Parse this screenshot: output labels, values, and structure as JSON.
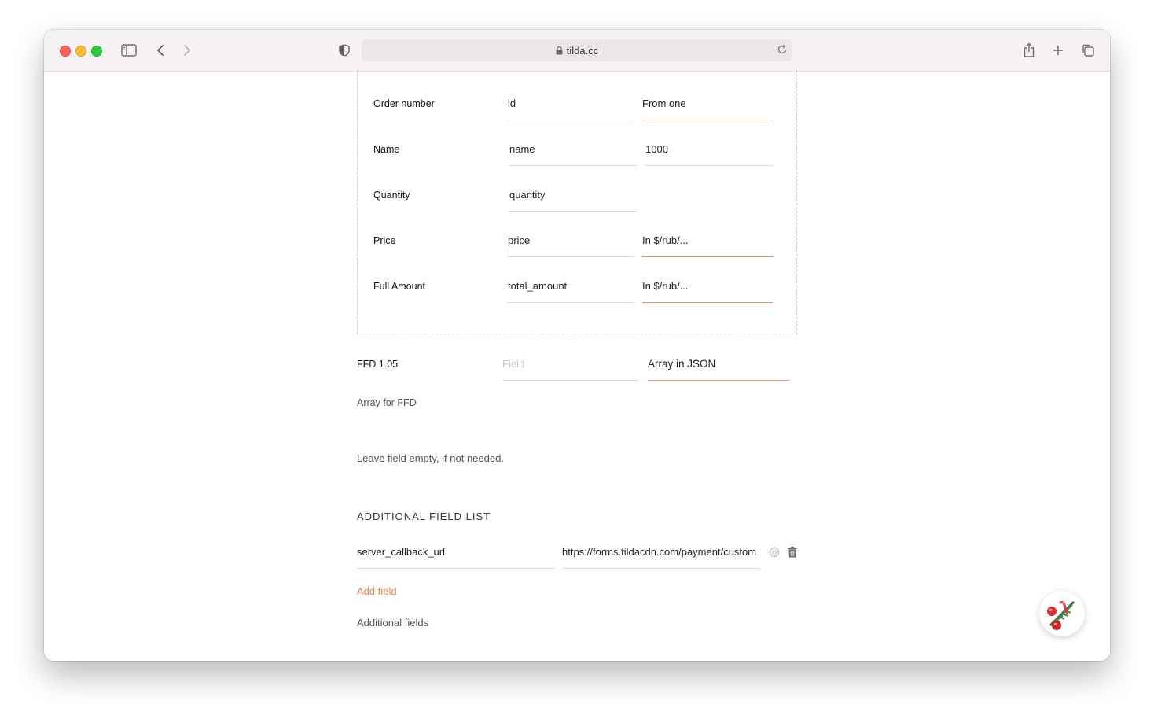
{
  "browser": {
    "url": "tilda.cc"
  },
  "mapping_rows": [
    {
      "label": "Order number",
      "key": "id",
      "option": "From one"
    },
    {
      "label": "Name",
      "key": "name",
      "option": "1000"
    },
    {
      "label": "Quantity",
      "key": "quantity",
      "option": ""
    },
    {
      "label": "Price",
      "key": "price",
      "option": "In $/rub/..."
    },
    {
      "label": "Full Amount",
      "key": "total_amount",
      "option": "In $/rub/..."
    }
  ],
  "ffd": {
    "label": "FFD 1.05",
    "field_placeholder": "Field",
    "format": "Array in JSON",
    "hint": "Array for FFD",
    "note": "Leave field empty, if not needed."
  },
  "additional": {
    "heading": "ADDITIONAL FIELD LIST",
    "field_name": "server_callback_url",
    "field_value": "https://forms.tildacdn.com/payment/custom",
    "add_label": "Add field",
    "footer_label": "Additional fields"
  },
  "colors": {
    "accent": "#f0834f",
    "accent_underline": "#e8907d"
  }
}
